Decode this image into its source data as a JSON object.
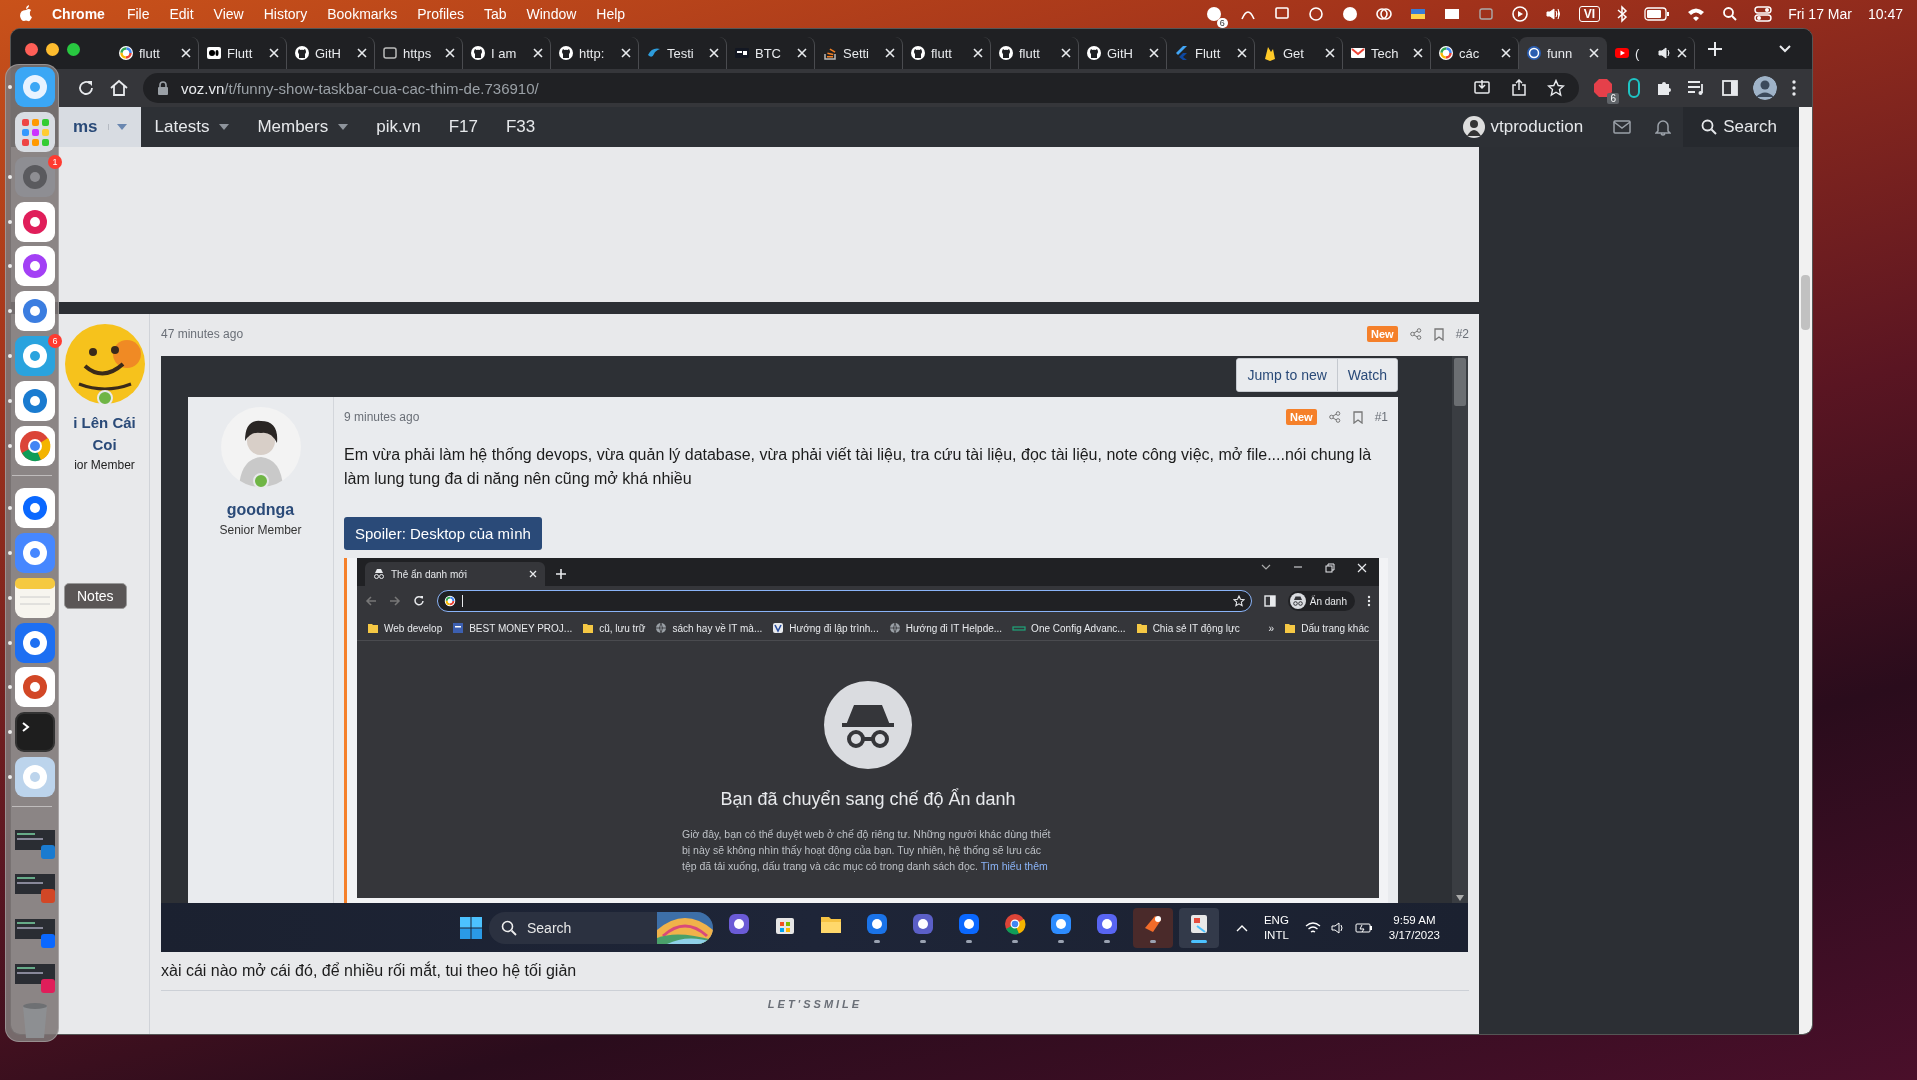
{
  "menu_bar": {
    "app": "Chrome",
    "menus": [
      "File",
      "Edit",
      "View",
      "History",
      "Bookmarks",
      "Profiles",
      "Tab",
      "Window",
      "Help"
    ],
    "status_badge": "6",
    "input_source": "VI",
    "date": "Fri 17 Mar",
    "time": "10:47"
  },
  "dock": {
    "apps": [
      {
        "kind": "finder",
        "running": true
      },
      {
        "kind": "launchpad",
        "running": false
      },
      {
        "kind": "settings",
        "running": true,
        "badge": "1"
      },
      {
        "kind": "slack",
        "running": true
      },
      {
        "kind": "messenger",
        "running": true
      },
      {
        "kind": "studio",
        "running": true
      },
      {
        "kind": "telegram",
        "running": true,
        "badge": "6"
      },
      {
        "kind": "vscode",
        "running": true
      },
      {
        "kind": "chrome",
        "running": true
      },
      {
        "kind": "zalo",
        "running": true
      },
      {
        "kind": "vpn",
        "running": true
      },
      {
        "kind": "notes",
        "running": true
      },
      {
        "kind": "xcode",
        "running": true
      },
      {
        "kind": "powerpoint",
        "running": true
      },
      {
        "kind": "terminal",
        "running": true
      },
      {
        "kind": "preview",
        "running": true
      }
    ],
    "windows": [
      {
        "kind": "vscode"
      },
      {
        "kind": "powerpoint"
      },
      {
        "kind": "zalo"
      },
      {
        "kind": "slack"
      }
    ],
    "tooltip": "Notes"
  },
  "browser": {
    "tabs": [
      {
        "title": "flutt",
        "kind": "google",
        "selected": false,
        "audio": false
      },
      {
        "title": "Flutt",
        "kind": "medium",
        "selected": false,
        "audio": false
      },
      {
        "title": "GitH",
        "kind": "github",
        "selected": false,
        "audio": false
      },
      {
        "title": "https",
        "kind": "generic",
        "selected": false,
        "audio": false
      },
      {
        "title": "I am",
        "kind": "github",
        "selected": false,
        "audio": false
      },
      {
        "title": "http:",
        "kind": "github",
        "selected": false,
        "audio": false
      },
      {
        "title": "Testi",
        "kind": "swirl",
        "selected": false,
        "audio": false
      },
      {
        "title": "BTC",
        "kind": "tv",
        "selected": false,
        "audio": false
      },
      {
        "title": "Setti",
        "kind": "stack",
        "selected": false,
        "audio": false
      },
      {
        "title": "flutt",
        "kind": "github",
        "selected": false,
        "audio": false
      },
      {
        "title": "flutt",
        "kind": "github",
        "selected": false,
        "audio": false
      },
      {
        "title": "GitH",
        "kind": "github",
        "selected": false,
        "audio": false
      },
      {
        "title": "Flutt",
        "kind": "flutter",
        "selected": false,
        "audio": false
      },
      {
        "title": "Get",
        "kind": "firebase",
        "selected": false,
        "audio": false
      },
      {
        "title": "Tech",
        "kind": "gmail",
        "selected": false,
        "audio": false
      },
      {
        "title": "các",
        "kind": "google",
        "selected": false,
        "audio": false
      },
      {
        "title": "funn",
        "kind": "voz",
        "selected": true,
        "audio": false
      },
      {
        "title": "(",
        "kind": "youtube",
        "selected": false,
        "audio": true
      }
    ],
    "url_host": "voz.vn",
    "url_path": "/t/funny-show-taskbar-cua-cac-thim-de.736910/",
    "extension_badge": "6"
  },
  "forum_nav": {
    "items": [
      {
        "label": "ms",
        "dropdown": true,
        "selected": true
      },
      {
        "label": "Latests",
        "dropdown": true,
        "selected": false
      },
      {
        "label": "Members",
        "dropdown": true,
        "selected": false
      },
      {
        "label": "pik.vn",
        "dropdown": false,
        "selected": false
      },
      {
        "label": "F17",
        "dropdown": false,
        "selected": false
      },
      {
        "label": "F33",
        "dropdown": false,
        "selected": false
      }
    ],
    "user": "vtproduction",
    "search": "Search"
  },
  "post": {
    "author_lines": [
      "i Lên Cái",
      "Coi"
    ],
    "author_title": "ior Member",
    "time": "47 minutes ago",
    "badge": "New",
    "number": "#2",
    "attachment": {
      "buttons": [
        "Jump to new",
        "Watch"
      ],
      "quoted_post": {
        "author": "goodnga",
        "author_title": "Senior Member",
        "time": "9 minutes ago",
        "badge": "New",
        "number": "#1",
        "text": "Em vừa phải làm hệ thống devops, vừa quản lý database, vừa phải viết tài liệu, tra cứu tài liệu, đọc tài liệu, note công việc, mở file....nói chung là làm lung tung đa di năng nên cũng mở khá nhiều",
        "spoiler": "Spoiler: Desktop của mình"
      },
      "incognito_window": {
        "tab": "Thẻ ẩn danh mới",
        "profile": "Ẩn danh",
        "bookmarks": [
          {
            "label": "Web develop",
            "kind": "folder"
          },
          {
            "label": "BEST MONEY PROJ...",
            "kind": "page"
          },
          {
            "label": "cũ, lưu trữ",
            "kind": "folder"
          },
          {
            "label": "sách hay về IT mà...",
            "kind": "globe"
          },
          {
            "label": "Hướng đi lập trình...",
            "kind": "badge"
          },
          {
            "label": "Hướng đi IT Helpde...",
            "kind": "globe"
          },
          {
            "label": "One Config Advanc...",
            "kind": "bar"
          },
          {
            "label": "Chia sẻ IT động lực",
            "kind": "folder"
          }
        ],
        "more": "»",
        "other_bookmarks": "Dấu trang khác",
        "heading": "Bạn đã chuyển sang chế độ Ẩn danh",
        "body": "Giờ đây, bạn có thể duyệt web ở chế độ riêng tư. Những người khác dùng thiết bị này sẽ không nhìn thấy hoạt động của bạn. Tuy nhiên, hệ thống sẽ lưu các tệp đã tải xuống, dấu trang và các mục có trong danh sách đọc.",
        "link": "Tìm hiểu thêm"
      },
      "taskbar": {
        "search": "Search",
        "apps": [
          {
            "kind": "meet",
            "running": false,
            "selected": false
          },
          {
            "kind": "store",
            "running": false,
            "selected": false
          },
          {
            "kind": "explorer",
            "running": false,
            "selected": false
          },
          {
            "kind": "remote",
            "running": true,
            "selected": false
          },
          {
            "kind": "teams",
            "running": true,
            "selected": false
          },
          {
            "kind": "zalo",
            "running": true,
            "selected": false
          },
          {
            "kind": "chrome",
            "running": true,
            "selected": false
          },
          {
            "kind": "zoom",
            "running": true,
            "selected": false
          },
          {
            "kind": "discord",
            "running": true,
            "selected": false
          },
          {
            "kind": "orange",
            "running": true,
            "selected": false
          },
          {
            "kind": "snip",
            "running": true,
            "selected": true
          }
        ],
        "language": "ENG",
        "layout": "INTL",
        "time": "9:59 AM",
        "date": "3/17/2023"
      }
    },
    "text": "xài cái nào mở cái đó, để nhiều rối mắt, tui theo hệ tối giản",
    "signature": "LET'SSMILE"
  }
}
